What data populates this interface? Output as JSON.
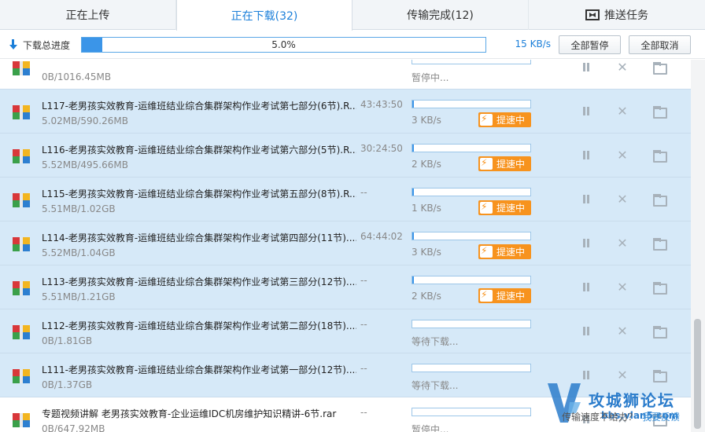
{
  "tabs": [
    {
      "label": "正在上传"
    },
    {
      "label": "正在下载(32)"
    },
    {
      "label": "传输完成(12)"
    },
    {
      "label": "推送任务"
    }
  ],
  "header": {
    "total_label": "下载总进度",
    "total_percent_text": "5.0%",
    "total_progress": 0.05,
    "total_speed": "15 KB/s",
    "pause_all": "全部暂停",
    "cancel_all": "全部取消"
  },
  "boost_label": "提速中",
  "colors": {
    "accent": "#1b7fd9",
    "selected_row": "#d6e9f8",
    "boost": "#f7931e"
  },
  "rows": [
    {
      "name": "",
      "size": "0B/1016.45MB",
      "time": "",
      "speed": "暂停中...",
      "progress": 0,
      "boost": false,
      "selected": false
    },
    {
      "name": "L117-老男孩实效教育-运维班结业综合集群架构作业考试第七部分(6节).R...",
      "size": "5.02MB/590.26MB",
      "time": "43:43:50",
      "speed": "3 KB/s",
      "progress": 0.01,
      "boost": true,
      "selected": true
    },
    {
      "name": "L116-老男孩实效教育-运维班结业综合集群架构作业考试第六部分(5节).R...",
      "size": "5.52MB/495.66MB",
      "time": "30:24:50",
      "speed": "2 KB/s",
      "progress": 0.011,
      "boost": true,
      "selected": true
    },
    {
      "name": "L115-老男孩实效教育-运维班结业综合集群架构作业考试第五部分(8节).R...",
      "size": "5.51MB/1.02GB",
      "time": "--",
      "speed": "1 KB/s",
      "progress": 0.005,
      "boost": true,
      "selected": true
    },
    {
      "name": "L114-老男孩实效教育-运维班结业综合集群架构作业考试第四部分(11节)....",
      "size": "5.52MB/1.04GB",
      "time": "64:44:02",
      "speed": "3 KB/s",
      "progress": 0.005,
      "boost": true,
      "selected": true
    },
    {
      "name": "L113-老男孩实效教育-运维班结业综合集群架构作业考试第三部分(12节)....",
      "size": "5.51MB/1.21GB",
      "time": "--",
      "speed": "2 KB/s",
      "progress": 0.004,
      "boost": true,
      "selected": true
    },
    {
      "name": "L112-老男孩实效教育-运维班结业综合集群架构作业考试第二部分(18节)....",
      "size": "0B/1.81GB",
      "time": "--",
      "speed": "等待下载...",
      "progress": 0,
      "boost": false,
      "selected": true
    },
    {
      "name": "L111-老男孩实效教育-运维班结业综合集群架构作业考试第一部分(12节)....",
      "size": "0B/1.37GB",
      "time": "--",
      "speed": "等待下载...",
      "progress": 0,
      "boost": false,
      "selected": true
    },
    {
      "name": "专题视频讲解 老男孩实效教育-企业运维IDC机房维护知识精讲-6节.rar",
      "size": "0B/647.92MB",
      "time": "--",
      "speed": "暂停中...",
      "progress": 0,
      "boost": false,
      "selected": false
    }
  ],
  "footer": {
    "feedback_text": "传输速度不给力？",
    "feedback_link": "我要反馈"
  },
  "watermark": {
    "title": "攻城狮论坛",
    "sub": "bbs.vlan5.com"
  }
}
